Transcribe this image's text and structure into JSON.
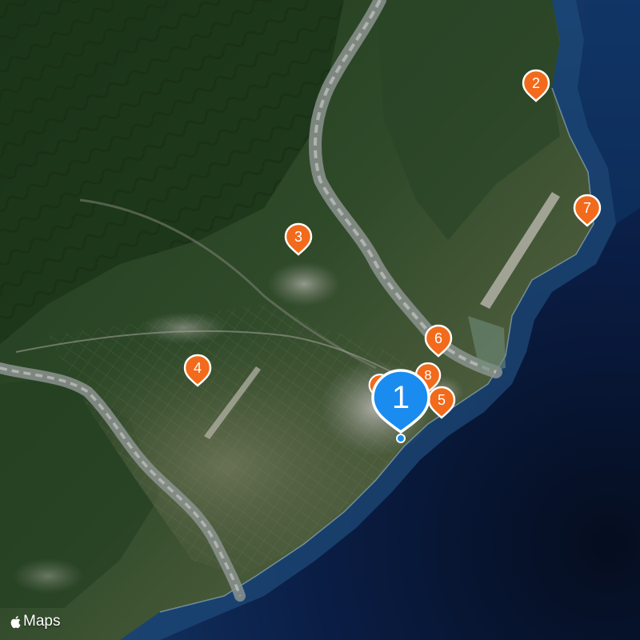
{
  "map": {
    "style": "satellite",
    "colors": {
      "sea_deep": "#07142e",
      "sea_mid": "#0e2a5e",
      "sea_coast": "#1f4f7d",
      "land_dark": "#1f3a1d",
      "land_mid": "#3b5a33",
      "plain": "#5b6b48",
      "urban": "#9a9c96",
      "river": "#9aa09c",
      "pin_orange": "#f26a1b",
      "pin_blue": "#1a8cf0"
    },
    "pins": [
      {
        "id": "pin-1",
        "label": "1",
        "kind": "primary",
        "selected": true,
        "color": "#1a8cf0"
      },
      {
        "id": "pin-2",
        "label": "2",
        "kind": "secondary",
        "color": "#f26a1b"
      },
      {
        "id": "pin-3",
        "label": "3",
        "kind": "secondary",
        "color": "#f26a1b"
      },
      {
        "id": "pin-4",
        "label": "4",
        "kind": "secondary",
        "color": "#f26a1b"
      },
      {
        "id": "pin-5",
        "label": "5",
        "kind": "secondary",
        "color": "#f26a1b"
      },
      {
        "id": "pin-6",
        "label": "6",
        "kind": "secondary",
        "color": "#f26a1b"
      },
      {
        "id": "pin-7",
        "label": "7",
        "kind": "secondary",
        "color": "#f26a1b"
      },
      {
        "id": "pin-8",
        "label": "8",
        "kind": "secondary",
        "color": "#f26a1b"
      }
    ],
    "attribution": {
      "icon": "apple-logo-icon",
      "text": "Maps"
    }
  }
}
